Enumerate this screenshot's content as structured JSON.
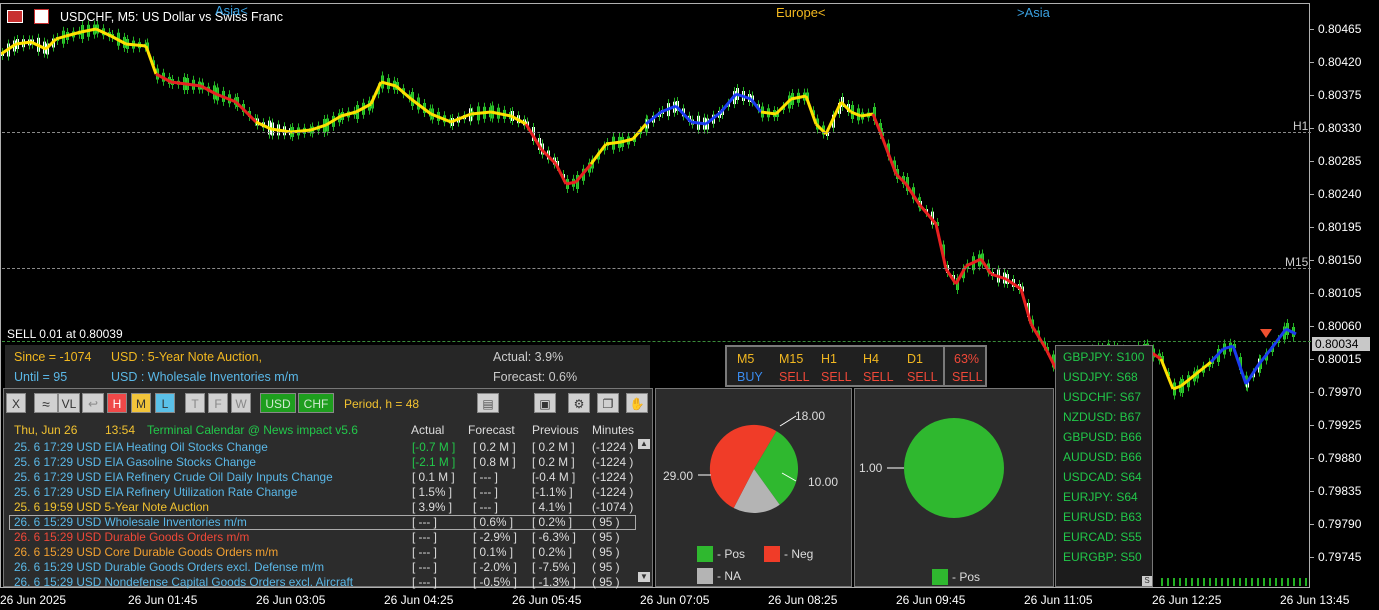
{
  "header": {
    "symbol_title": "USDCHF, M5:  US Dollar vs Swiss Franc",
    "sessions": [
      "Asia<",
      "Europe<",
      ">Asia"
    ]
  },
  "price_axis": [
    "0.80465",
    "0.80420",
    "0.80375",
    "0.80330",
    "0.80285",
    "0.80240",
    "0.80195",
    "0.80150",
    "0.80105",
    "0.80060",
    "0.80015",
    "0.79970",
    "0.79925",
    "0.79880",
    "0.79835",
    "0.79790",
    "0.79745"
  ],
  "current_price": "0.80034",
  "level_labels": {
    "h1": "H1",
    "m15": "M15"
  },
  "time_axis": [
    "26 Jun 2025",
    "26 Jun 01:45",
    "26 Jun 03:05",
    "26 Jun 04:25",
    "26 Jun 05:45",
    "26 Jun 07:05",
    "26 Jun 08:25",
    "26 Jun 09:45",
    "26 Jun 11:05",
    "26 Jun 12:25",
    "26 Jun 13:45"
  ],
  "trade_line": "SELL 0.01 at 0.80039",
  "info": {
    "since": "Since = -1074",
    "until": "Until =  95",
    "event1": "USD : 5-Year Note Auction,",
    "event2": "USD : Wholesale Inventories m/m",
    "actual": "Actual: 3.9%",
    "forecast": "Forecast: 0.6%"
  },
  "signals": {
    "timeframes": [
      "M5",
      "M15",
      "H1",
      "H4",
      "D1"
    ],
    "values": [
      "BUY",
      "SELL",
      "SELL",
      "SELL",
      "SELL"
    ],
    "percent": "63%",
    "overall": "SELL"
  },
  "toolbar": {
    "buttons": [
      "X",
      "VL",
      "H",
      "M",
      "L",
      "T",
      "F",
      "W",
      "USD",
      "CHF"
    ],
    "period": "Period, h = 48"
  },
  "calendar": {
    "date": "Thu, Jun 26",
    "time": "13:54",
    "title": "Terminal Calendar @ News impact v5.6",
    "columns": [
      "Actual",
      "Forecast",
      "Previous",
      "Minutes"
    ],
    "rows": [
      {
        "event": "25. 6 17:29 USD EIA Heating Oil Stocks Change",
        "actual": "[-0.7 M ]",
        "forecast": "[ 0.2 M ]",
        "previous": "[ 0.2 M ]",
        "minutes": "(-1224 )",
        "color": "#5ab8e8",
        "actual_color": "#22c84a"
      },
      {
        "event": "25. 6 17:29 USD EIA Gasoline Stocks Change",
        "actual": "[-2.1 M ]",
        "forecast": "[ 0.8 M ]",
        "previous": "[ 0.2 M ]",
        "minutes": "(-1224 )",
        "color": "#5ab8e8",
        "actual_color": "#22c84a"
      },
      {
        "event": "25. 6 17:29 USD EIA Refinery Crude Oil Daily Inputs Change",
        "actual": "[ 0.1 M ]",
        "forecast": "[ --- ]",
        "previous": "[-0.4 M ]",
        "minutes": "(-1224 )",
        "color": "#5ab8e8",
        "actual_color": "#dddddd"
      },
      {
        "event": "25. 6 17:29 USD EIA Refinery Utilization Rate Change",
        "actual": "[ 1.5% ]",
        "forecast": "[ --- ]",
        "previous": "[-1.1% ]",
        "minutes": "(-1224 )",
        "color": "#5ab8e8",
        "actual_color": "#dddddd"
      },
      {
        "event": "25. 6 19:59 USD 5-Year Note Auction",
        "actual": "[ 3.9% ]",
        "forecast": "[ --- ]",
        "previous": "[ 4.1% ]",
        "minutes": "(-1074 )",
        "color": "#f2c230",
        "actual_color": "#dddddd"
      },
      {
        "event": "26. 6 15:29 USD Wholesale Inventories m/m",
        "actual": "[ --- ]",
        "forecast": "[ 0.6% ]",
        "previous": "[ 0.2% ]",
        "minutes": "( 95 )",
        "color": "#5ab8e8",
        "actual_color": "#dddddd"
      },
      {
        "event": "26. 6 15:29 USD Durable Goods Orders m/m",
        "actual": "[ --- ]",
        "forecast": "[ -2.9% ]",
        "previous": "[ -6.3% ]",
        "minutes": "( 95 )",
        "color": "#f04838",
        "actual_color": "#dddddd"
      },
      {
        "event": "26. 6 15:29 USD Core Durable Goods Orders m/m",
        "actual": "[ --- ]",
        "forecast": "[ 0.1% ]",
        "previous": "[ 0.2% ]",
        "minutes": "( 95 )",
        "color": "#f2a030",
        "actual_color": "#dddddd"
      },
      {
        "event": "26. 6 15:29 USD Durable Goods Orders excl. Defense m/m",
        "actual": "[ --- ]",
        "forecast": "[ -2.0% ]",
        "previous": "[ -7.5% ]",
        "minutes": "( 95 )",
        "color": "#5ab8e8",
        "actual_color": "#dddddd"
      },
      {
        "event": "26. 6 15:29 USD Nondefense Capital Goods Orders excl. Aircraft",
        "actual": "[ --- ]",
        "forecast": "[ -0.5% ]",
        "previous": "[ -1.3% ]",
        "minutes": "( 95 )",
        "color": "#5ab8e8",
        "actual_color": "#dddddd"
      }
    ]
  },
  "pie1": {
    "labels": [
      "18.00",
      "10.00",
      "29.00"
    ],
    "legend": [
      "- Pos",
      "- Neg",
      "- NA"
    ],
    "colors": [
      "#2fb82f",
      "#f03c28",
      "#b4b4b4"
    ]
  },
  "pie2": {
    "label": "1.00",
    "legend": "- Pos",
    "color": "#2fb82f"
  },
  "strength": [
    "GBPJPY: S100",
    "USDJPY: S68",
    "USDCHF: S67",
    "NZDUSD: B67",
    "GBPUSD: B66",
    "AUDUSD: B66",
    "USDCAD: S64",
    "EURJPY: S64",
    "EURUSD: B63",
    "EURCAD: S55",
    "EURGBP: S50"
  ]
}
